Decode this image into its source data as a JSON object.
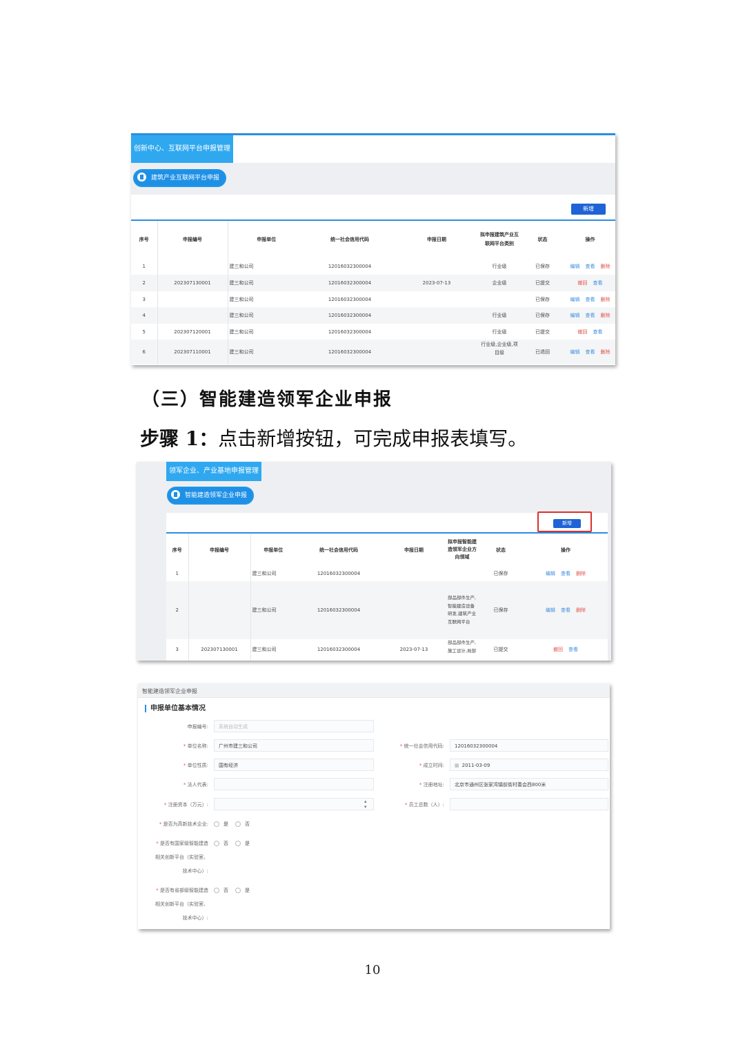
{
  "shot1": {
    "tab_title": "创新中心、互联网平台申报管理",
    "sub_pill": "建筑产业互联网平台申报",
    "add_button": "新增",
    "headers": [
      "序号",
      "申报编号",
      "申报单位",
      "统一社会信用代码",
      "申报日期",
      "拟申报建筑产业互联网平台类别",
      "状态",
      "操作"
    ],
    "rows": [
      {
        "seq": "1",
        "no": "",
        "unit": "建三和公司",
        "code": "12016032300004",
        "date": "",
        "cat": "行业级",
        "status": "已保存",
        "a1": "编辑",
        "a2": "查看",
        "a3": "删除"
      },
      {
        "seq": "2",
        "no": "202307130001",
        "unit": "建三和公司",
        "code": "12016032300004",
        "date": "2023-07-13",
        "cat": "企业级",
        "status": "已提交",
        "a1": "撤回",
        "a2": "查看",
        "a3": ""
      },
      {
        "seq": "3",
        "no": "",
        "unit": "建三和公司",
        "code": "12016032300004",
        "date": "",
        "cat": "",
        "status": "已保存",
        "a1": "编辑",
        "a2": "查看",
        "a3": "删除"
      },
      {
        "seq": "4",
        "no": "",
        "unit": "建三和公司",
        "code": "12016032300004",
        "date": "",
        "cat": "行业级",
        "status": "已保存",
        "a1": "编辑",
        "a2": "查看",
        "a3": "删除"
      },
      {
        "seq": "5",
        "no": "202307120001",
        "unit": "建三和公司",
        "code": "12016032300004",
        "date": "",
        "cat": "行业级",
        "status": "已提交",
        "a1": "撤回",
        "a2": "查看",
        "a3": ""
      },
      {
        "seq": "6",
        "no": "202307110001",
        "unit": "建三和公司",
        "code": "12016032300004",
        "date": "",
        "cat": "行业级,企业级,项目级",
        "status": "已退回",
        "a1": "编辑",
        "a2": "查看",
        "a3": "删除"
      }
    ]
  },
  "heading": "（三）智能建造领军企业申报",
  "step": {
    "label": "步骤 1：",
    "text": "点击新增按钮，可完成申报表填写。"
  },
  "shot2": {
    "tab_title": "领军企业、产业基地申报管理",
    "sub_pill": "智能建造领军企业申报",
    "add_button": "新增",
    "headers": [
      "序号",
      "申报编号",
      "申报单位",
      "统一社会信用代码",
      "申报日期",
      "拟申报智能建造领军企业方向领域",
      "状态",
      "操作"
    ],
    "rows": [
      {
        "seq": "1",
        "no": "",
        "unit": "建三和公司",
        "code": "12016032300004",
        "date": "",
        "cat": "",
        "status": "已保存",
        "a1": "编辑",
        "a2": "查看",
        "a3": "删除"
      },
      {
        "seq": "2",
        "no": "",
        "unit": "建三和公司",
        "code": "12016032300004",
        "date": "",
        "cat": "部品部件生产,智能建造设备研发,建筑产业互联网平台",
        "status": "已保存",
        "a1": "编辑",
        "a2": "查看",
        "a3": "删除"
      },
      {
        "seq": "3",
        "no": "202307130001",
        "unit": "建三和公司",
        "code": "12016032300004",
        "date": "2023-07-13",
        "cat": "部品部件生产,施工设计,局部",
        "status": "已提交",
        "a1": "撤回",
        "a2": "查看",
        "a3": ""
      }
    ]
  },
  "shot3": {
    "form_title": "智能建造领军企业申报",
    "section": "申报单位基本情况",
    "fields": {
      "report_no_label": "申报编号:",
      "report_no_placeholder": "系统自动生成",
      "unit_name_label": "单位名称:",
      "unit_name_value": "广州市建三和公司",
      "credit_code_label": "统一社会信用代码:",
      "credit_code_value": "12016032300004",
      "nature_label": "单位性质:",
      "nature_value": "国有经济",
      "founded_label": "成立时间:",
      "founded_value": "2011-03-09",
      "legal_label": "法人代表:",
      "legal_value": "",
      "address_label": "注册地址:",
      "address_value": "北京市通州区张家湾镇前街村委会西800米",
      "capital_label": "注册资本（万元）:",
      "capital_value": "",
      "staff_label": "员工总数（人）:",
      "staff_value": "",
      "hightech_label": "是否为高新技术企业:",
      "hightech_opt1": "是",
      "hightech_opt2": "否",
      "national_label_1": "是否有国家级智能建造",
      "national_label_2": "相关创新平台（实验室、",
      "national_label_3": "技术中心）:",
      "national_opt1": "否",
      "national_opt2": "是",
      "provincial_label_1": "是否有省部级智能建造",
      "provincial_label_2": "相关创新平台（实验室、",
      "provincial_label_3": "技术中心）:",
      "provincial_opt1": "否",
      "provincial_opt2": "是"
    }
  },
  "page_number": "10"
}
